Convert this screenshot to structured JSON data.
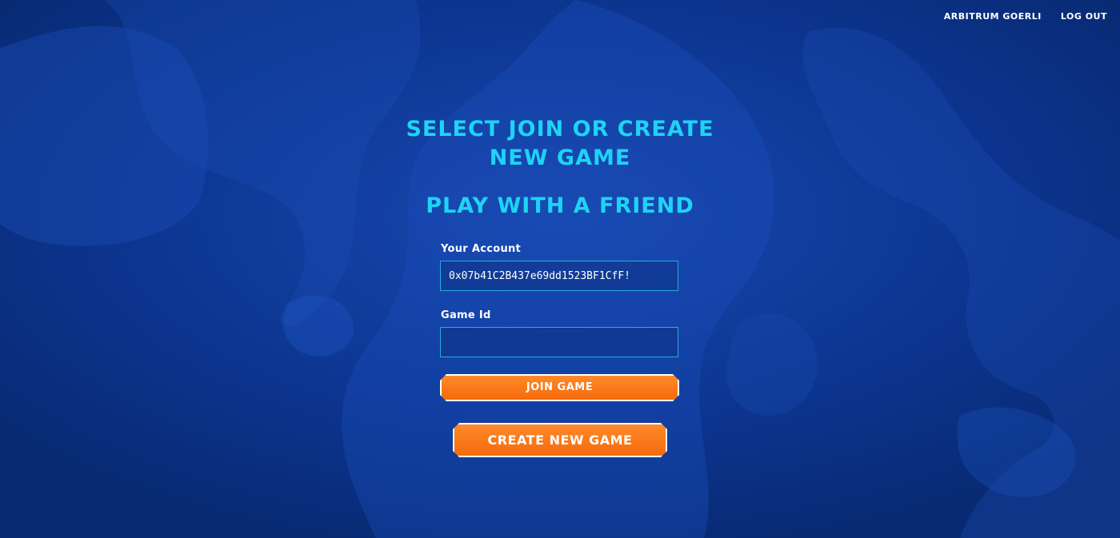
{
  "nav": {
    "network_label": "ARBITRUM GOERLI",
    "logout_label": "LOG OUT"
  },
  "main": {
    "title_line1": "SELECT JOIN OR CREATE",
    "title_line2": "NEW GAME",
    "subtitle": "PLAY WITH A FRIEND",
    "account": {
      "label": "Your Account",
      "value": "0x07b41C2B437e69dd1523BF1CfF!"
    },
    "game_id": {
      "label": "Game Id",
      "value": "",
      "placeholder": ""
    },
    "join_label": "JOIN GAME",
    "create_label": "CREATE NEW GAME"
  },
  "colors": {
    "background": "#0a2a78",
    "accent_cyan": "#1fd3f5",
    "button_orange": "#f46a0c",
    "field_border": "#2aa9e0"
  }
}
